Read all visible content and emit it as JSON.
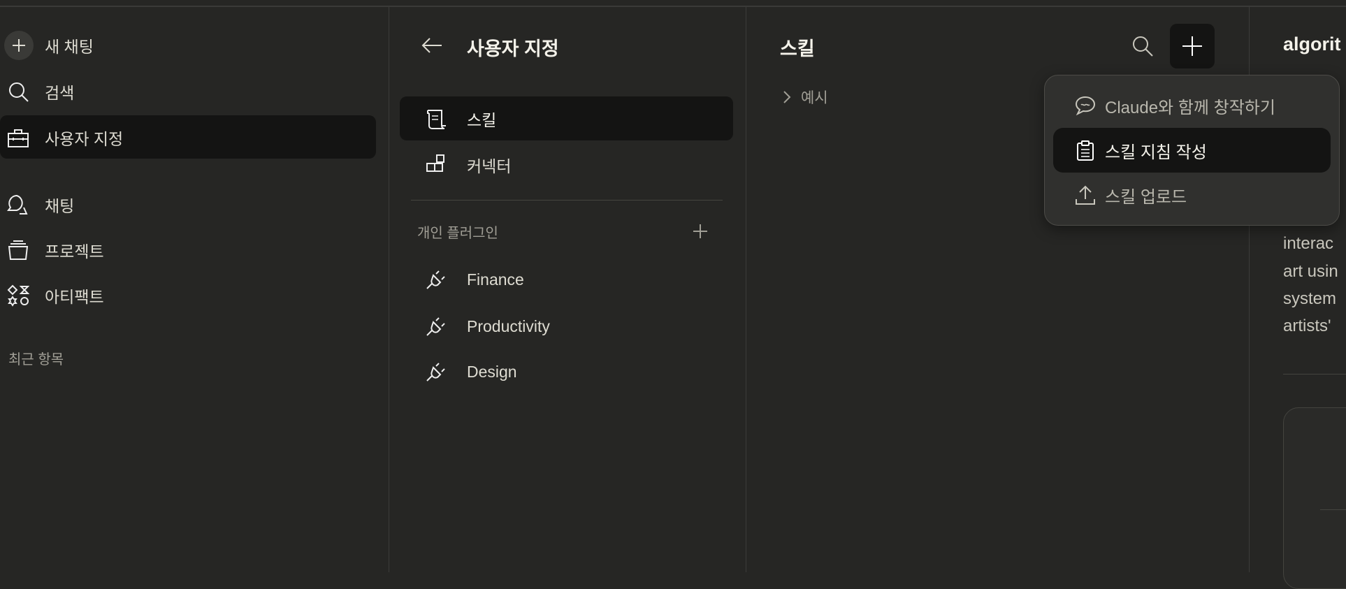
{
  "sidebar": {
    "new_chat": "새 채팅",
    "search": "검색",
    "customize": "사용자 지정",
    "chats": "채팅",
    "projects": "프로젝트",
    "artifacts": "아티팩트",
    "recents": "최근 항목"
  },
  "customize_panel": {
    "title": "사용자 지정",
    "items": [
      {
        "label": "스킬"
      },
      {
        "label": "커넥터"
      }
    ],
    "plugins_heading": "개인 플러그인",
    "plugins": [
      {
        "label": "Finance"
      },
      {
        "label": "Productivity"
      },
      {
        "label": "Design"
      }
    ]
  },
  "skills_panel": {
    "title": "스킬",
    "group": "예시"
  },
  "add_menu": {
    "items": [
      {
        "label": "Claude와 함께 창작하기"
      },
      {
        "label": "스킬 지침 작성"
      },
      {
        "label": "스킬 업로드"
      }
    ]
  },
  "detail": {
    "title": "algorit",
    "lines": [
      "interac",
      "art usin",
      "system",
      "artists'"
    ]
  },
  "colors": {
    "bg": "#262624",
    "selected": "#141413",
    "menu": "#30302e"
  }
}
